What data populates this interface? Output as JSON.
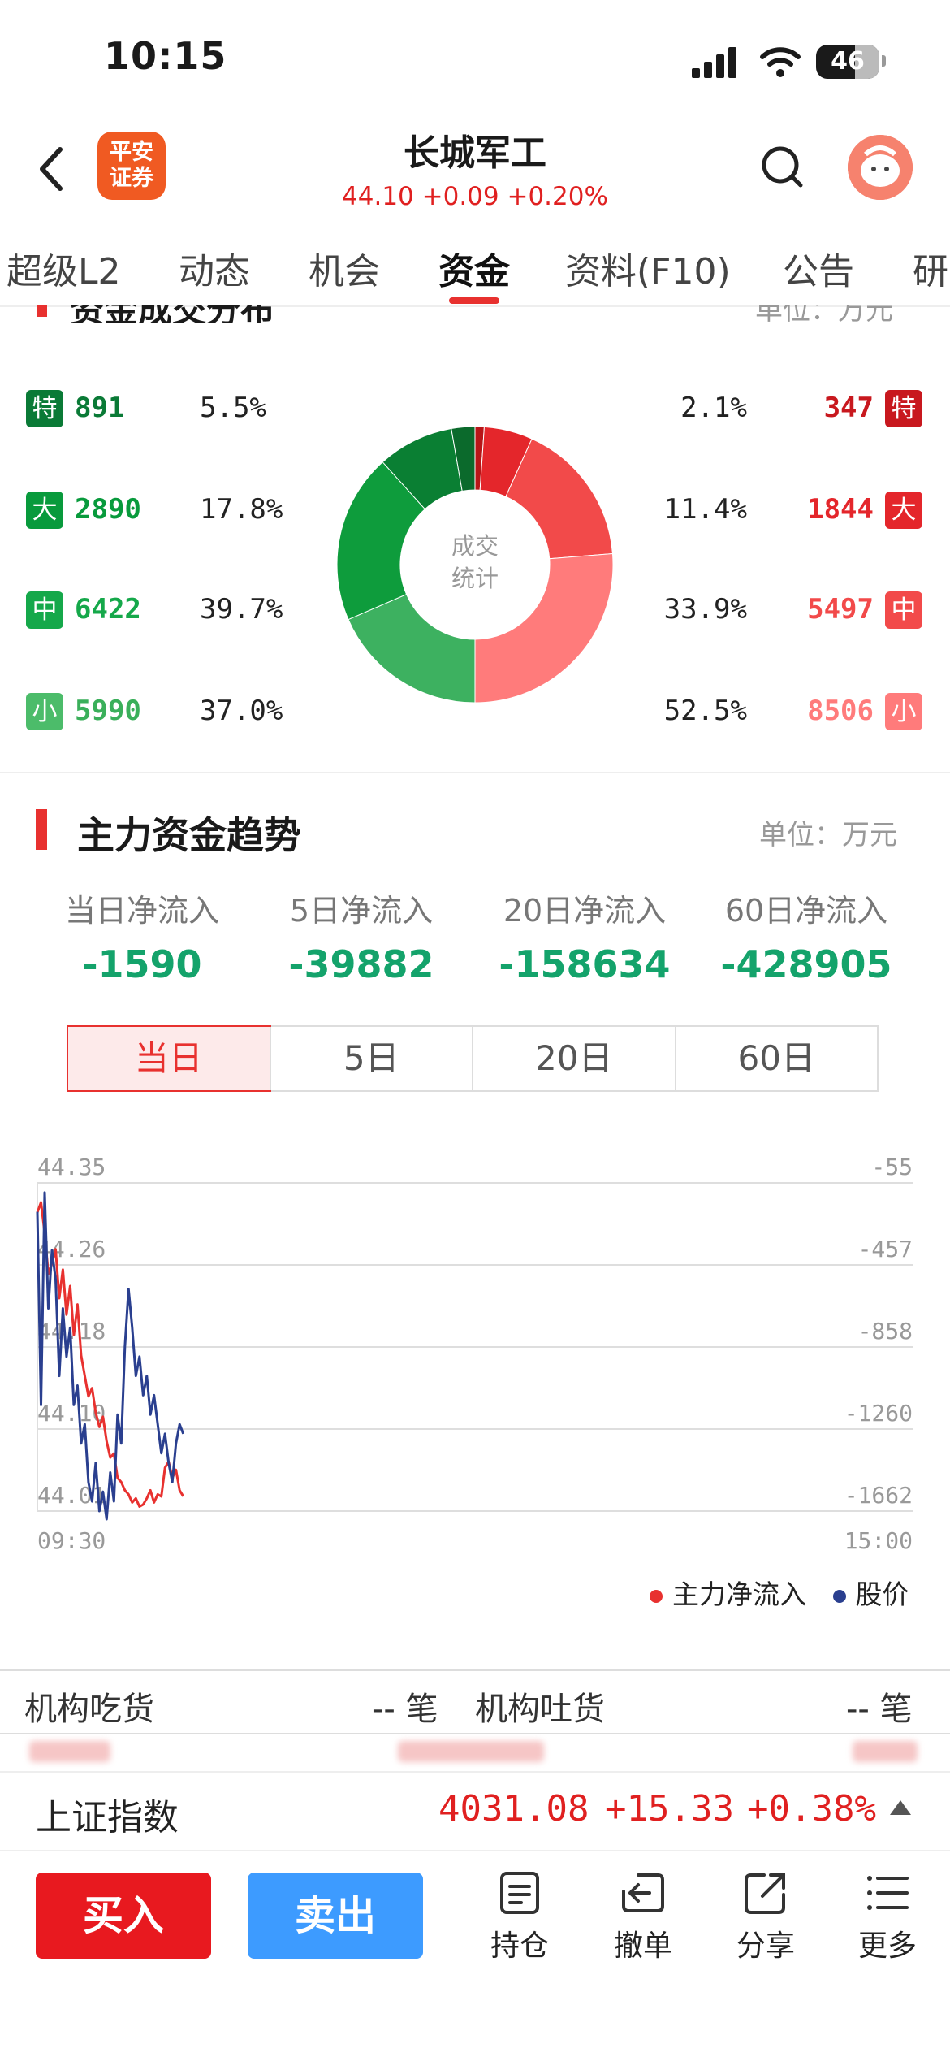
{
  "status_bar": {
    "time": "10:15",
    "battery": "46"
  },
  "header": {
    "broker_logo": "平安\n证券",
    "stock_name": "长城军工",
    "quote": "44.10 +0.09 +0.20%"
  },
  "tabs": [
    "超级L2",
    "动态",
    "机会",
    "资金",
    "资料(F10)",
    "公告",
    "研"
  ],
  "active_tab": "资金",
  "distribution": {
    "title": "资金成交分布",
    "unit": "单位：万元",
    "center_label_1": "成交",
    "center_label_2": "统计",
    "buy": [
      {
        "badge": "特",
        "amount": "891",
        "pct": "5.5%",
        "color": "#0a7a36"
      },
      {
        "badge": "大",
        "amount": "2890",
        "pct": "17.8%",
        "color": "#089a3c"
      },
      {
        "badge": "中",
        "amount": "6422",
        "pct": "39.7%",
        "color": "#15a84a"
      },
      {
        "badge": "小",
        "amount": "5990",
        "pct": "37.0%",
        "color": "#4cbc6a"
      }
    ],
    "sell": [
      {
        "badge": "特",
        "amount": "347",
        "pct": "2.1%",
        "color": "#c8181e"
      },
      {
        "badge": "大",
        "amount": "1844",
        "pct": "11.4%",
        "color": "#e4262b"
      },
      {
        "badge": "中",
        "amount": "5497",
        "pct": "33.9%",
        "color": "#f24a4a"
      },
      {
        "badge": "小",
        "amount": "8506",
        "pct": "52.5%",
        "color": "#ff7b7b"
      }
    ],
    "donut_slices": [
      {
        "side": "sell",
        "level": "特",
        "value": 347,
        "color": "#b81518"
      },
      {
        "side": "sell",
        "level": "大",
        "value": 1844,
        "color": "#e4262b"
      },
      {
        "side": "sell",
        "level": "中",
        "value": 5497,
        "color": "#f24a4a"
      },
      {
        "side": "sell",
        "level": "小",
        "value": 8506,
        "color": "#ff7b7b"
      },
      {
        "side": "buy",
        "level": "小",
        "value": 5990,
        "color": "#3db160"
      },
      {
        "side": "buy",
        "level": "中",
        "value": 6422,
        "color": "#0e9c3c"
      },
      {
        "side": "buy",
        "level": "大",
        "value": 2890,
        "color": "#0a7f33"
      },
      {
        "side": "buy",
        "level": "特",
        "value": 891,
        "color": "#0b6a2c"
      }
    ]
  },
  "main_force": {
    "title": "主力资金趋势",
    "unit": "单位：万元",
    "flows": [
      {
        "label": "当日净流入",
        "value": "-1590"
      },
      {
        "label": "5日净流入",
        "value": "-39882"
      },
      {
        "label": "20日净流入",
        "value": "-158634"
      },
      {
        "label": "60日净流入",
        "value": "-428905"
      }
    ],
    "period_tabs": [
      "当日",
      "5日",
      "20日",
      "60日"
    ],
    "active_period": "当日"
  },
  "chart_data": {
    "type": "line",
    "x_start": "09:30",
    "x_end": "15:00",
    "price_ticks": [
      "44.35",
      "44.26",
      "44.18",
      "44.10",
      "44.01"
    ],
    "flow_ticks": [
      "-55",
      "-457",
      "-858",
      "-1260",
      "-1662"
    ],
    "price_range": [
      44.01,
      44.35
    ],
    "flow_range": [
      -1662,
      -55
    ],
    "grid": true,
    "legend_position": "bottom-right",
    "series": [
      {
        "name": "主力净流入",
        "color": "#e8312f",
        "axis": "right",
        "values": [
          -200,
          -150,
          -300,
          -500,
          -450,
          -380,
          -620,
          -480,
          -700,
          -560,
          -800,
          -650,
          -900,
          -1000,
          -1100,
          -1060,
          -1180,
          -1250,
          -1200,
          -1320,
          -1400,
          -1380,
          -1500,
          -1520,
          -1560,
          -1580,
          -1620,
          -1600,
          -1640,
          -1630,
          -1600,
          -1560,
          -1620,
          -1580,
          -1590,
          -1450,
          -1420,
          -1500,
          -1460,
          -1560,
          -1590
        ]
      },
      {
        "name": "股价",
        "color": "#2a3f8f",
        "axis": "left",
        "values": [
          44.32,
          44.12,
          44.34,
          44.22,
          44.28,
          44.25,
          44.15,
          44.22,
          44.17,
          44.2,
          44.12,
          44.14,
          44.08,
          44.1,
          44.04,
          44.02,
          44.06,
          44.01,
          44.03,
          44.0,
          44.05,
          44.02,
          44.11,
          44.08,
          44.18,
          44.24,
          44.2,
          44.15,
          44.17,
          44.13,
          44.15,
          44.11,
          44.13,
          44.1,
          44.07,
          44.09,
          44.06,
          44.04,
          44.08,
          44.1,
          44.09
        ]
      }
    ]
  },
  "institution": {
    "eat_label": "机构吃货",
    "eat_value": "-- 笔",
    "spit_label": "机构吐货",
    "spit_value": "-- 笔"
  },
  "index_bar": {
    "name": "上证指数",
    "value": "4031.08",
    "change": "+15.33",
    "pct": "+0.38%"
  },
  "toolbar": {
    "buy": "买入",
    "sell": "卖出",
    "holdings": "持仓",
    "cancel": "撤单",
    "share": "分享",
    "more": "更多"
  }
}
